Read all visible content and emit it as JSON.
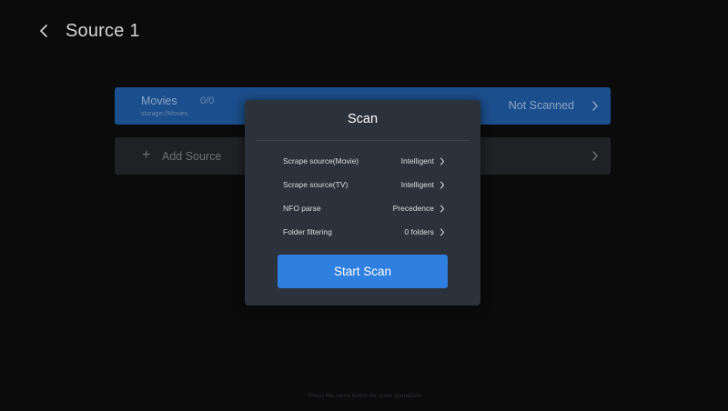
{
  "header": {
    "title": "Source 1"
  },
  "sources": {
    "movies": {
      "name": "Movies",
      "count": "0/0",
      "path": "storage://Movies",
      "status": "Not Scanned"
    },
    "add": {
      "plus": "+",
      "label": "Add Source"
    }
  },
  "modal": {
    "title": "Scan",
    "options": [
      {
        "label": "Scrape source(Movie)",
        "value": "Intelligent"
      },
      {
        "label": "Scrape source(TV)",
        "value": "Intelligent"
      },
      {
        "label": "NFO parse",
        "value": "Precedence"
      },
      {
        "label": "Folder filtering",
        "value": "0 folders"
      }
    ],
    "start_label": "Start Scan"
  },
  "footer": {
    "hint": "*Press the menu button for more operations"
  },
  "colors": {
    "accent": "#2f7fe0",
    "selected_card": "#1b4e8c",
    "modal_bg": "#2c323b"
  }
}
